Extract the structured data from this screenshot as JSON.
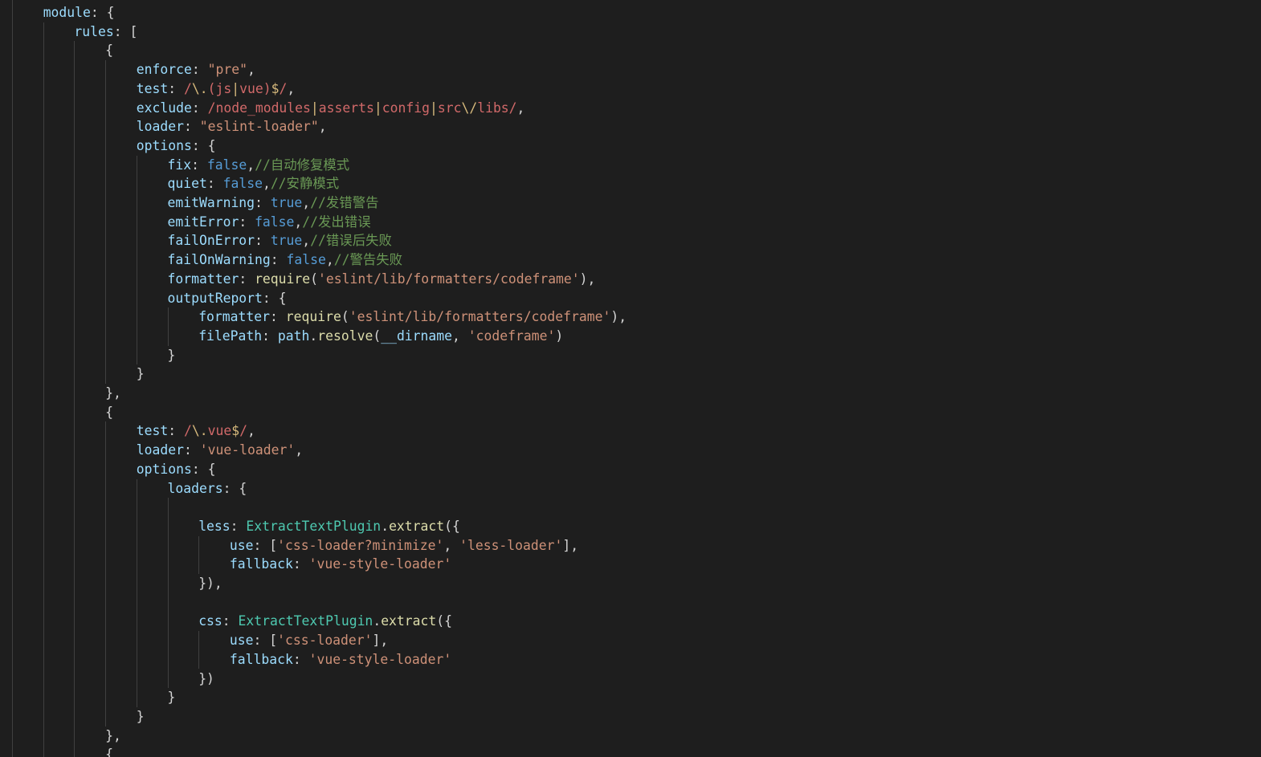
{
  "theme": {
    "background": "#1e1e1e",
    "indent_guide": "#404040",
    "colors": {
      "key": "#9cdcfe",
      "string": "#ce9178",
      "regex": "#d16969",
      "boolean": "#569cd6",
      "comment": "#6a9955",
      "function": "#dcdcaa",
      "class": "#4ec9b0",
      "punctuation": "#d4d4d4",
      "escape": "#d7ba7d"
    }
  },
  "lines": [
    {
      "indent": 1,
      "tokens": [
        {
          "t": "key",
          "v": "module"
        },
        {
          "t": "punc",
          "v": ": {"
        }
      ]
    },
    {
      "indent": 2,
      "tokens": [
        {
          "t": "key",
          "v": "rules"
        },
        {
          "t": "punc",
          "v": ": ["
        }
      ]
    },
    {
      "indent": 3,
      "tokens": [
        {
          "t": "punc",
          "v": "{"
        }
      ]
    },
    {
      "indent": 4,
      "tokens": [
        {
          "t": "key",
          "v": "enforce"
        },
        {
          "t": "punc",
          "v": ": "
        },
        {
          "t": "str",
          "v": "\"pre\""
        },
        {
          "t": "punc",
          "v": ","
        }
      ]
    },
    {
      "indent": 4,
      "tokens": [
        {
          "t": "key",
          "v": "test"
        },
        {
          "t": "punc",
          "v": ": "
        },
        {
          "t": "re",
          "v": "/"
        },
        {
          "t": "esc",
          "v": "\\."
        },
        {
          "t": "re",
          "v": "(js"
        },
        {
          "t": "esc",
          "v": "|"
        },
        {
          "t": "re",
          "v": "vue)"
        },
        {
          "t": "esc",
          "v": "$"
        },
        {
          "t": "re",
          "v": "/"
        },
        {
          "t": "punc",
          "v": ","
        }
      ]
    },
    {
      "indent": 4,
      "tokens": [
        {
          "t": "key",
          "v": "exclude"
        },
        {
          "t": "punc",
          "v": ": "
        },
        {
          "t": "re",
          "v": "/node_modules"
        },
        {
          "t": "esc",
          "v": "|"
        },
        {
          "t": "re",
          "v": "asserts"
        },
        {
          "t": "esc",
          "v": "|"
        },
        {
          "t": "re",
          "v": "config"
        },
        {
          "t": "esc",
          "v": "|"
        },
        {
          "t": "re",
          "v": "src"
        },
        {
          "t": "esc",
          "v": "\\/"
        },
        {
          "t": "re",
          "v": "libs/"
        },
        {
          "t": "punc",
          "v": ","
        }
      ]
    },
    {
      "indent": 4,
      "tokens": [
        {
          "t": "key",
          "v": "loader"
        },
        {
          "t": "punc",
          "v": ": "
        },
        {
          "t": "str",
          "v": "\"eslint-loader\""
        },
        {
          "t": "punc",
          "v": ","
        }
      ]
    },
    {
      "indent": 4,
      "tokens": [
        {
          "t": "key",
          "v": "options"
        },
        {
          "t": "punc",
          "v": ": {"
        }
      ]
    },
    {
      "indent": 5,
      "tokens": [
        {
          "t": "key",
          "v": "fix"
        },
        {
          "t": "punc",
          "v": ": "
        },
        {
          "t": "bool",
          "v": "false"
        },
        {
          "t": "punc",
          "v": ","
        },
        {
          "t": "cmt",
          "v": "//自动修复模式"
        }
      ]
    },
    {
      "indent": 5,
      "tokens": [
        {
          "t": "key",
          "v": "quiet"
        },
        {
          "t": "punc",
          "v": ": "
        },
        {
          "t": "bool",
          "v": "false"
        },
        {
          "t": "punc",
          "v": ","
        },
        {
          "t": "cmt",
          "v": "//安静模式"
        }
      ]
    },
    {
      "indent": 5,
      "tokens": [
        {
          "t": "key",
          "v": "emitWarning"
        },
        {
          "t": "punc",
          "v": ": "
        },
        {
          "t": "bool",
          "v": "true"
        },
        {
          "t": "punc",
          "v": ","
        },
        {
          "t": "cmt",
          "v": "//发错警告"
        }
      ]
    },
    {
      "indent": 5,
      "tokens": [
        {
          "t": "key",
          "v": "emitError"
        },
        {
          "t": "punc",
          "v": ": "
        },
        {
          "t": "bool",
          "v": "false"
        },
        {
          "t": "punc",
          "v": ","
        },
        {
          "t": "cmt",
          "v": "//发出错误"
        }
      ]
    },
    {
      "indent": 5,
      "tokens": [
        {
          "t": "key",
          "v": "failOnError"
        },
        {
          "t": "punc",
          "v": ": "
        },
        {
          "t": "bool",
          "v": "true"
        },
        {
          "t": "punc",
          "v": ","
        },
        {
          "t": "cmt",
          "v": "//错误后失败"
        }
      ]
    },
    {
      "indent": 5,
      "tokens": [
        {
          "t": "key",
          "v": "failOnWarning"
        },
        {
          "t": "punc",
          "v": ": "
        },
        {
          "t": "bool",
          "v": "false"
        },
        {
          "t": "punc",
          "v": ","
        },
        {
          "t": "cmt",
          "v": "//警告失败"
        }
      ]
    },
    {
      "indent": 5,
      "tokens": [
        {
          "t": "key",
          "v": "formatter"
        },
        {
          "t": "punc",
          "v": ": "
        },
        {
          "t": "fn",
          "v": "require"
        },
        {
          "t": "punc",
          "v": "("
        },
        {
          "t": "str",
          "v": "'eslint/lib/formatters/codeframe'"
        },
        {
          "t": "punc",
          "v": "),"
        }
      ]
    },
    {
      "indent": 5,
      "tokens": [
        {
          "t": "key",
          "v": "outputReport"
        },
        {
          "t": "punc",
          "v": ": {"
        }
      ]
    },
    {
      "indent": 6,
      "tokens": [
        {
          "t": "key",
          "v": "formatter"
        },
        {
          "t": "punc",
          "v": ": "
        },
        {
          "t": "fn",
          "v": "require"
        },
        {
          "t": "punc",
          "v": "("
        },
        {
          "t": "str",
          "v": "'eslint/lib/formatters/codeframe'"
        },
        {
          "t": "punc",
          "v": "),"
        }
      ]
    },
    {
      "indent": 6,
      "tokens": [
        {
          "t": "key",
          "v": "filePath"
        },
        {
          "t": "punc",
          "v": ": "
        },
        {
          "t": "key",
          "v": "path"
        },
        {
          "t": "punc",
          "v": "."
        },
        {
          "t": "fn",
          "v": "resolve"
        },
        {
          "t": "punc",
          "v": "("
        },
        {
          "t": "key",
          "v": "__dirname"
        },
        {
          "t": "punc",
          "v": ", "
        },
        {
          "t": "str",
          "v": "'codeframe'"
        },
        {
          "t": "punc",
          "v": ")"
        }
      ]
    },
    {
      "indent": 5,
      "tokens": [
        {
          "t": "punc",
          "v": "}"
        }
      ]
    },
    {
      "indent": 4,
      "tokens": [
        {
          "t": "punc",
          "v": "}"
        }
      ]
    },
    {
      "indent": 3,
      "tokens": [
        {
          "t": "punc",
          "v": "},"
        }
      ]
    },
    {
      "indent": 3,
      "tokens": [
        {
          "t": "punc",
          "v": "{"
        }
      ]
    },
    {
      "indent": 4,
      "tokens": [
        {
          "t": "key",
          "v": "test"
        },
        {
          "t": "punc",
          "v": ": "
        },
        {
          "t": "re",
          "v": "/"
        },
        {
          "t": "esc",
          "v": "\\."
        },
        {
          "t": "re",
          "v": "vue"
        },
        {
          "t": "esc",
          "v": "$"
        },
        {
          "t": "re",
          "v": "/"
        },
        {
          "t": "punc",
          "v": ","
        }
      ]
    },
    {
      "indent": 4,
      "tokens": [
        {
          "t": "key",
          "v": "loader"
        },
        {
          "t": "punc",
          "v": ": "
        },
        {
          "t": "str",
          "v": "'vue-loader'"
        },
        {
          "t": "punc",
          "v": ","
        }
      ]
    },
    {
      "indent": 4,
      "tokens": [
        {
          "t": "key",
          "v": "options"
        },
        {
          "t": "punc",
          "v": ": {"
        }
      ]
    },
    {
      "indent": 5,
      "tokens": [
        {
          "t": "key",
          "v": "loaders"
        },
        {
          "t": "punc",
          "v": ": {"
        }
      ]
    },
    {
      "indent": 6,
      "tokens": []
    },
    {
      "indent": 6,
      "tokens": [
        {
          "t": "key",
          "v": "less"
        },
        {
          "t": "punc",
          "v": ": "
        },
        {
          "t": "cls",
          "v": "ExtractTextPlugin"
        },
        {
          "t": "punc",
          "v": "."
        },
        {
          "t": "fn",
          "v": "extract"
        },
        {
          "t": "punc",
          "v": "({"
        }
      ]
    },
    {
      "indent": 7,
      "tokens": [
        {
          "t": "key",
          "v": "use"
        },
        {
          "t": "punc",
          "v": ": ["
        },
        {
          "t": "str",
          "v": "'css-loader?minimize'"
        },
        {
          "t": "punc",
          "v": ", "
        },
        {
          "t": "str",
          "v": "'less-loader'"
        },
        {
          "t": "punc",
          "v": "],"
        }
      ]
    },
    {
      "indent": 7,
      "tokens": [
        {
          "t": "key",
          "v": "fallback"
        },
        {
          "t": "punc",
          "v": ": "
        },
        {
          "t": "str",
          "v": "'vue-style-loader'"
        }
      ]
    },
    {
      "indent": 6,
      "tokens": [
        {
          "t": "punc",
          "v": "}),"
        }
      ]
    },
    {
      "indent": 6,
      "tokens": []
    },
    {
      "indent": 6,
      "tokens": [
        {
          "t": "key",
          "v": "css"
        },
        {
          "t": "punc",
          "v": ": "
        },
        {
          "t": "cls",
          "v": "ExtractTextPlugin"
        },
        {
          "t": "punc",
          "v": "."
        },
        {
          "t": "fn",
          "v": "extract"
        },
        {
          "t": "punc",
          "v": "({"
        }
      ]
    },
    {
      "indent": 7,
      "tokens": [
        {
          "t": "key",
          "v": "use"
        },
        {
          "t": "punc",
          "v": ": ["
        },
        {
          "t": "str",
          "v": "'css-loader'"
        },
        {
          "t": "punc",
          "v": "],"
        }
      ]
    },
    {
      "indent": 7,
      "tokens": [
        {
          "t": "key",
          "v": "fallback"
        },
        {
          "t": "punc",
          "v": ": "
        },
        {
          "t": "str",
          "v": "'vue-style-loader'"
        }
      ]
    },
    {
      "indent": 6,
      "tokens": [
        {
          "t": "punc",
          "v": "})"
        }
      ]
    },
    {
      "indent": 5,
      "tokens": [
        {
          "t": "punc",
          "v": "}"
        }
      ]
    },
    {
      "indent": 4,
      "tokens": [
        {
          "t": "punc",
          "v": "}"
        }
      ]
    },
    {
      "indent": 3,
      "tokens": [
        {
          "t": "punc",
          "v": "},"
        }
      ]
    },
    {
      "indent": 3,
      "tokens": [
        {
          "t": "punc",
          "v": "{"
        }
      ]
    }
  ]
}
